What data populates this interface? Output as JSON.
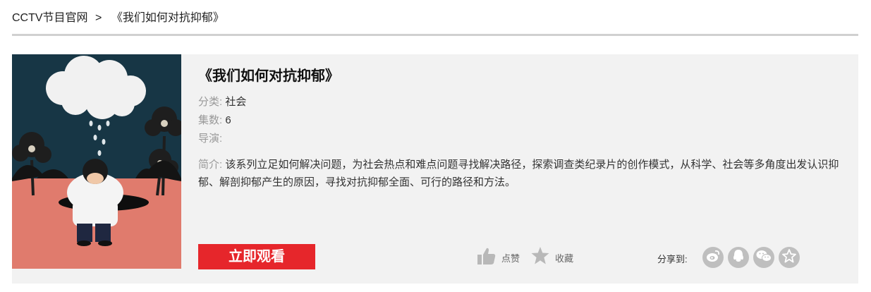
{
  "breadcrumb": {
    "home": "CCTV节目官网",
    "separator": ">",
    "current": "《我们如何对抗抑郁》"
  },
  "program": {
    "title": "《我们如何对抗抑郁》",
    "category_label": "分类:",
    "category": "社会",
    "episodes_label": "集数:",
    "episodes": "6",
    "director_label": "导演:",
    "director": "",
    "intro_label": "简介:",
    "intro": "该系列立足如何解决问题，为社会热点和难点问题寻找解决路径，探索调查类纪录片的创作模式，从科学、社会等多角度出发认识抑郁、解剖抑郁产生的原因，寻找对抗抑郁全面、可行的路径和方法。"
  },
  "actions": {
    "watch": "立即观看",
    "like": "点赞",
    "favorite": "收藏",
    "share_label": "分享到:"
  },
  "share_icons": [
    "weibo-icon",
    "qq-icon",
    "wechat-icon",
    "qzone-icon"
  ],
  "colors": {
    "accent": "#e6262b",
    "panel_bg": "#f2f2f2",
    "icon_gray": "#bfbfbf",
    "poster_sky": "#173645",
    "poster_ground": "#e07b6d"
  }
}
